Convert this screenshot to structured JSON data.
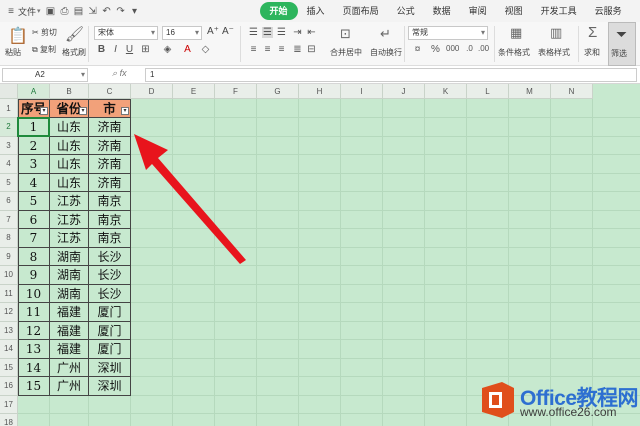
{
  "app": {
    "file_menu": "文件",
    "ribbon_tabs": [
      "开始",
      "插入",
      "页面布局",
      "公式",
      "数据",
      "审阅",
      "视图",
      "开发工具",
      "云服务"
    ],
    "active_tab_index": 0,
    "accent_color": "#2db55d"
  },
  "ribbon": {
    "cut": "剪切",
    "paste": "粘贴",
    "copy": "复制",
    "format_painter": "格式刷",
    "font_name": "宋体",
    "font_size": "16",
    "font_grow": "A⁺",
    "font_shrink": "A⁻",
    "bold": "B",
    "italic": "I",
    "underline": "U",
    "merge_center": "合并居中",
    "wrap_text": "自动换行",
    "number_format": "常规",
    "percent": "%",
    "cond_format": "条件格式",
    "table_style": "表格样式",
    "sum": "求和",
    "filter": "筛选"
  },
  "formula_bar": {
    "name_box": "A2",
    "fx_label": "fx",
    "content": "1"
  },
  "sheet": {
    "columns": [
      "A",
      "B",
      "C",
      "D",
      "E",
      "F",
      "G",
      "H",
      "I",
      "J",
      "K",
      "L",
      "M",
      "N"
    ],
    "row_numbers": [
      "1",
      "2",
      "3",
      "4",
      "5",
      "6",
      "7",
      "8",
      "9",
      "10",
      "11",
      "12",
      "13",
      "14",
      "15",
      "16",
      "17",
      "18"
    ],
    "selected_cell": "A2",
    "header_fill": "#f2a17a",
    "sheet_background": "#c7e9cf",
    "headers": [
      "序号",
      "省份",
      "市"
    ],
    "rows": [
      [
        "1",
        "山东",
        "济南"
      ],
      [
        "2",
        "山东",
        "济南"
      ],
      [
        "3",
        "山东",
        "济南"
      ],
      [
        "4",
        "山东",
        "济南"
      ],
      [
        "5",
        "江苏",
        "南京"
      ],
      [
        "6",
        "江苏",
        "南京"
      ],
      [
        "7",
        "江苏",
        "南京"
      ],
      [
        "8",
        "湖南",
        "长沙"
      ],
      [
        "9",
        "湖南",
        "长沙"
      ],
      [
        "10",
        "湖南",
        "长沙"
      ],
      [
        "11",
        "福建",
        "厦门"
      ],
      [
        "12",
        "福建",
        "厦门"
      ],
      [
        "13",
        "福建",
        "厦门"
      ],
      [
        "14",
        "广州",
        "深圳"
      ],
      [
        "15",
        "广州",
        "深圳"
      ]
    ]
  },
  "watermark": {
    "brand": "Office教程网",
    "url": "www.office26.com"
  }
}
